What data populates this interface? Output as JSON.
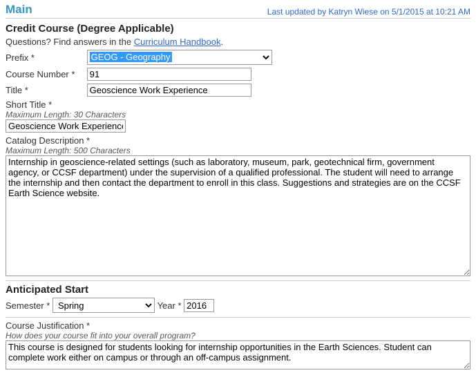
{
  "header": {
    "title": "Main",
    "updated": "Last updated by Katryn Wiese on 5/1/2015 at 10:21 AM"
  },
  "credit": {
    "heading": "Credit Course (Degree Applicable)",
    "questions_prefix": "Questions? Find answers in the ",
    "handbook_link": "Curriculum Handbook",
    "prefix_label": "Prefix *",
    "prefix_value": "GEOG - Geography",
    "course_number_label": "Course Number *",
    "course_number_value": "91",
    "title_label": "Title *",
    "title_value": "Geoscience Work Experience",
    "short_title_label": "Short Title *",
    "short_title_hint": "Maximum Length: 30 Characters",
    "short_title_value": "Geoscience Work Experience",
    "catalog_label": "Catalog Description *",
    "catalog_hint": "Maximum Length: 500 Characters",
    "catalog_value": "Internship in geoscience-related settings (such as laboratory, museum, park, geotechnical firm, government agency, or CCSF department) under the supervision of a qualified professional. The student will need to arrange the internship and then contact the department to enroll in this class. Suggestions and strategies are on the CCSF Earth Science website."
  },
  "anticipated": {
    "heading": "Anticipated Start",
    "semester_label": "Semester *",
    "semester_value": "Spring",
    "year_label": "Year *",
    "year_value": "2016"
  },
  "justification": {
    "label": "Course Justification *",
    "hint": "How does your course fit into your overall program?",
    "value": "This course is designed for students looking for internship opportunities in the Earth Sciences. Student can complete work either on campus or through an off-campus assignment."
  }
}
